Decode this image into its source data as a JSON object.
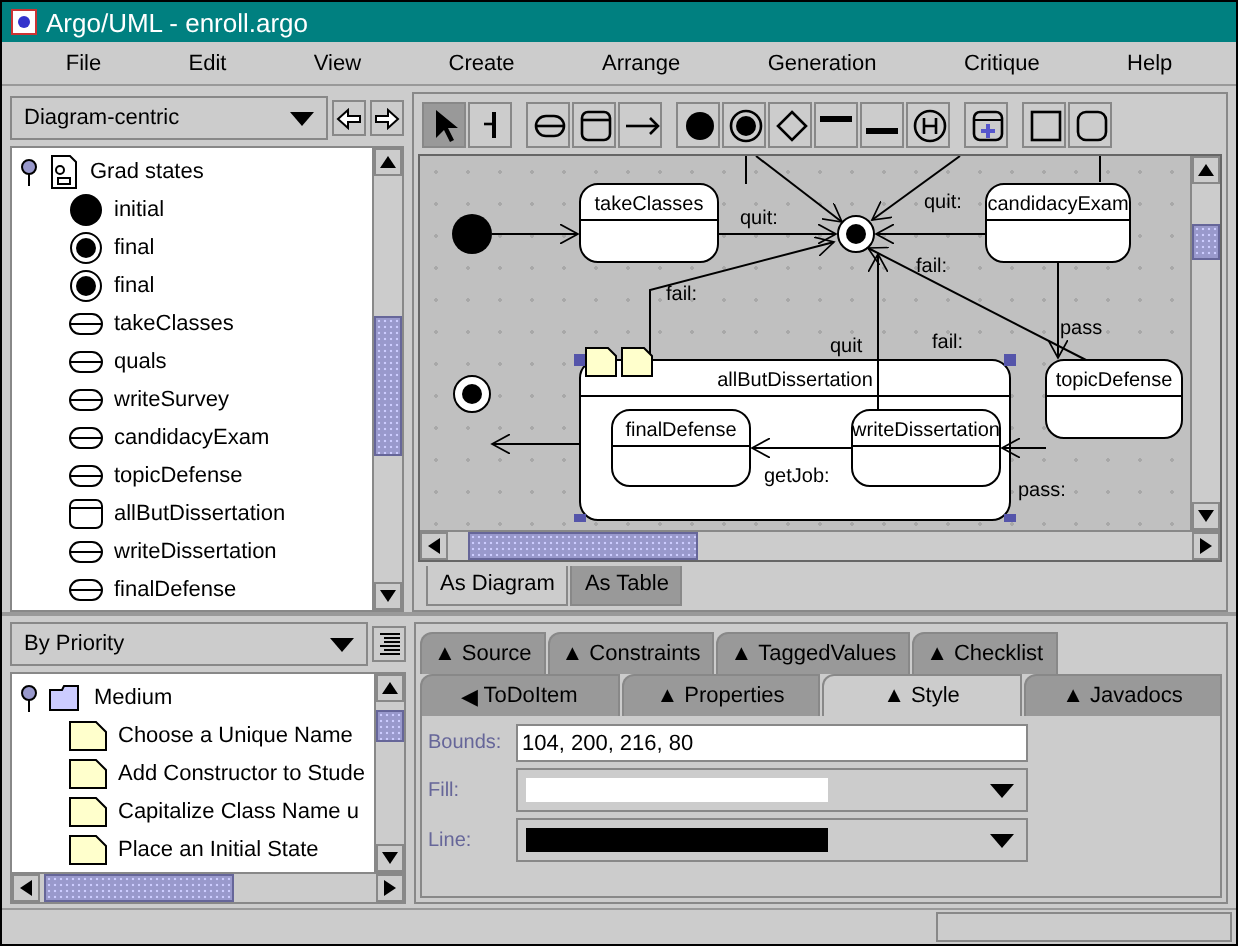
{
  "window": {
    "title": "Argo/UML - enroll.argo"
  },
  "menu": [
    "File",
    "Edit",
    "View",
    "Create",
    "Arrange",
    "Generation",
    "Critique",
    "Help"
  ],
  "navigator": {
    "perspective": "Diagram-centric",
    "root": {
      "label": "Grad states",
      "expanded": true,
      "children": [
        {
          "kind": "initial",
          "label": "initial"
        },
        {
          "kind": "final",
          "label": "final"
        },
        {
          "kind": "final",
          "label": "final"
        },
        {
          "kind": "state",
          "label": "takeClasses"
        },
        {
          "kind": "state",
          "label": "quals"
        },
        {
          "kind": "state",
          "label": "writeSurvey"
        },
        {
          "kind": "state",
          "label": "candidacyExam"
        },
        {
          "kind": "state",
          "label": "topicDefense"
        },
        {
          "kind": "composite",
          "label": "allButDissertation"
        },
        {
          "kind": "state",
          "label": "writeDissertation"
        },
        {
          "kind": "state",
          "label": "finalDefense"
        }
      ]
    }
  },
  "toolbar": [
    {
      "kind": "select",
      "selected": true
    },
    {
      "kind": "broom",
      "selected": false
    },
    {
      "kind": "state",
      "selected": false
    },
    {
      "kind": "composite",
      "selected": false
    },
    {
      "kind": "transition",
      "selected": false
    },
    {
      "kind": "initial",
      "selected": false
    },
    {
      "kind": "final",
      "selected": false
    },
    {
      "kind": "branch",
      "selected": false
    },
    {
      "kind": "fork",
      "selected": false
    },
    {
      "kind": "join",
      "selected": false
    },
    {
      "kind": "history",
      "selected": false
    },
    {
      "kind": "add",
      "selected": false
    },
    {
      "kind": "rect",
      "selected": false
    },
    {
      "kind": "rounded",
      "selected": false
    }
  ],
  "diagram": {
    "nodes": [
      {
        "kind": "initial"
      },
      {
        "kind": "state",
        "name": "takeClasses"
      },
      {
        "kind": "final"
      },
      {
        "kind": "state",
        "name": "candidacyExam"
      },
      {
        "kind": "state",
        "name": "topicDefense"
      },
      {
        "kind": "composite",
        "name": "allButDissertation",
        "selected": true
      },
      {
        "kind": "state",
        "name": "finalDefense"
      },
      {
        "kind": "state",
        "name": "writeDissertation"
      },
      {
        "kind": "final"
      }
    ],
    "transitions": [
      "quit:",
      "quit:",
      "fail:",
      "fail:",
      "quit",
      "fail:",
      "pass",
      "getJob:",
      "pass:"
    ]
  },
  "view_tabs": [
    {
      "label": "As Diagram",
      "selected": true
    },
    {
      "label": "As Table",
      "selected": false
    }
  ],
  "todo": {
    "grouping": "By Priority",
    "root": {
      "label": "Medium",
      "expanded": true,
      "children": [
        "Choose a Unique Name",
        "Add Constructor to Stude",
        "Capitalize Class Name u",
        "Place an Initial State"
      ]
    }
  },
  "detail_tabs": [
    [
      {
        "glyph": "▲",
        "label": "Source",
        "selected": false
      },
      {
        "glyph": "▲",
        "label": "Constraints",
        "selected": false
      },
      {
        "glyph": "▲",
        "label": "TaggedValues",
        "selected": false
      },
      {
        "glyph": "▲",
        "label": "Checklist",
        "selected": false
      }
    ],
    [
      {
        "glyph": "◀",
        "label": "ToDoItem",
        "selected": false
      },
      {
        "glyph": "▲",
        "label": "Properties",
        "selected": false
      },
      {
        "glyph": "▲",
        "label": "Style",
        "selected": true
      },
      {
        "glyph": "▲",
        "label": "Javadocs",
        "selected": false
      }
    ]
  ],
  "style": {
    "bounds": {
      "label": "Bounds:",
      "value": "104, 200, 216, 80"
    },
    "fill": {
      "label": "Fill:",
      "color": "#ffffff"
    },
    "line": {
      "label": "Line:",
      "color": "#000000"
    }
  }
}
